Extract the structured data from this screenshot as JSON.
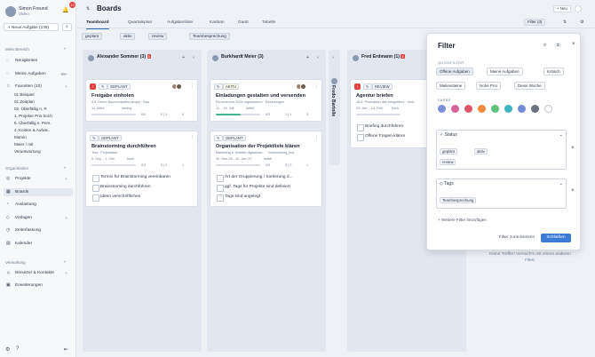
{
  "user": {
    "name": "Simon Freund",
    "subtitle": "Video",
    "badge": "19"
  },
  "sidebar": {
    "new_task": "+ Neue Aufgabe (139)",
    "sec1": "Mein Bereich",
    "items1": [
      {
        "label": "Neuigkeiten",
        "icon": "◌"
      },
      {
        "label": "Meine Aufgaben",
        "icon": "◌",
        "count": "99+"
      },
      {
        "label": "Favoriten (10)",
        "icon": "☆"
      }
    ],
    "favs": [
      "01 Beispiel",
      "01 Zeitplan",
      "02. Überfällig n. P.",
      "1. Projekte Prio hoch",
      "5. Überfällig n. Pers.",
      "4. Kosten & Aufwä..",
      "Marvin",
      "Meier / mit",
      "Verantwortung"
    ],
    "sec2": "Organisation",
    "items2": [
      {
        "label": "Projekte",
        "icon": "◎"
      },
      {
        "label": "Boards",
        "icon": "▦"
      },
      {
        "label": "Auslastung",
        "icon": "◔"
      },
      {
        "label": "Vorlagen",
        "icon": "◇"
      },
      {
        "label": "Zeiterfassung",
        "icon": "◷"
      },
      {
        "label": "Kalender",
        "icon": "▤"
      }
    ],
    "sec3": "Verwaltung",
    "items3": [
      {
        "label": "Benutzer & Kontakte",
        "icon": "☺"
      },
      {
        "label": "Erweiterungen",
        "icon": "▣"
      }
    ]
  },
  "header": {
    "title": "Boards",
    "new_label": "+ Neu",
    "filter_label": "Filter (3)"
  },
  "tabs": [
    "Teamboard",
    "Quartalsplan",
    "Aufgabenliste",
    "Kanban",
    "Gantt",
    "Tabelle"
  ],
  "active_filters": [
    "geplant",
    "aktiv",
    "review",
    "Teambesprechung"
  ],
  "columns": [
    {
      "name": "Alexander Sommer",
      "count": "(3)",
      "badge": "3"
    },
    {
      "name": "Burkhardt Meier",
      "count": "(3)"
    },
    {
      "name": "Fredo Bartolle",
      "collapsed": true
    },
    {
      "name": "Fred Erdmann",
      "count": "(1)",
      "badge": "1"
    }
  ],
  "cards": {
    "c1": {
      "status": "GEPLANT",
      "title": "Freigabe einholen",
      "meta": "4.9. Demo Baurecht(alles simpel · Bau",
      "date": "11. März",
      "prio": "niedrig",
      "stats": [
        "0/0",
        "0 | 0",
        "4"
      ]
    },
    "c2": {
      "status": "GEPLANT",
      "title": "Brainstorming durchführen",
      "meta": "Test · Projektstart",
      "date": "5. Sep. - 1. Okt.",
      "prio": "hoch",
      "stats": [
        "0/3",
        "0 | 0",
        "1"
      ],
      "checks": [
        "Termin für Brainstorming vereinbaren",
        "Brainstorming durchführen",
        "Ideen verschriftlichen"
      ]
    },
    "c3": {
      "status": "AKTIV",
      "title": "Einladungen gestalten und versenden",
      "meta": "Firmenevent 2024 organisieren · Einladungen",
      "date": "11. - 19. Juli",
      "prio": "mittel",
      "stats": [
        "0/3",
        "1 | 1",
        "3"
      ]
    },
    "c4": {
      "status": "GEPLANT",
      "title": "Organisation der Projektliste klären",
      "meta": "Marketing & Vertrieb digitalisier... · Vorbereitung_fest",
      "date": "30. Nov.'26 - 16. Jan.'27",
      "prio": "mittel",
      "stats": [
        "0/3",
        "0 | 0",
        "1"
      ],
      "checks": [
        "Art der Gruppierung / Sortierung d...",
        "ggf. Tags für Projekte sind definiert",
        "Tags sind angelegt"
      ]
    },
    "c5": {
      "status": "REVIEW",
      "title": "Agentur briefen",
      "meta": "16.5. Produktion des Imagefilms · Vorb.",
      "date": "29. Jan. - 13. Feb.",
      "prio": "hoch",
      "stats": [
        "0/2",
        "0 | 0",
        "3"
      ],
      "checks": [
        "Briefing durchführen",
        "Offene Fragen klären"
      ]
    }
  },
  "filter_panel": {
    "title": "Filter",
    "quick_label": "QUICKFILTER",
    "quick": [
      "Offene Aufgaben",
      "Meine Aufgaben",
      "Kritisch",
      "Meilensteine",
      "Hohe Prio",
      "Diese Woche"
    ],
    "color_label": "FARBE",
    "colors": [
      "#7b8fd6",
      "#d6649b",
      "#e0556a",
      "#f08a3c",
      "#5ec27a",
      "#3fb5c0",
      "#6f8ad6",
      "#6b7280"
    ],
    "status_label": "Status",
    "status_chips": [
      "geplant",
      "aktiv",
      "review"
    ],
    "tags_label": "Tags",
    "tag_chips": [
      "Teambesprechung"
    ],
    "add_more": "+ Weitere Filter hinzufügen",
    "reset": "Filter zurücksetzen",
    "close": "Schließen",
    "count": "3"
  },
  "empty": "Keine Treffer! Versuch's mit einem anderen Filter."
}
